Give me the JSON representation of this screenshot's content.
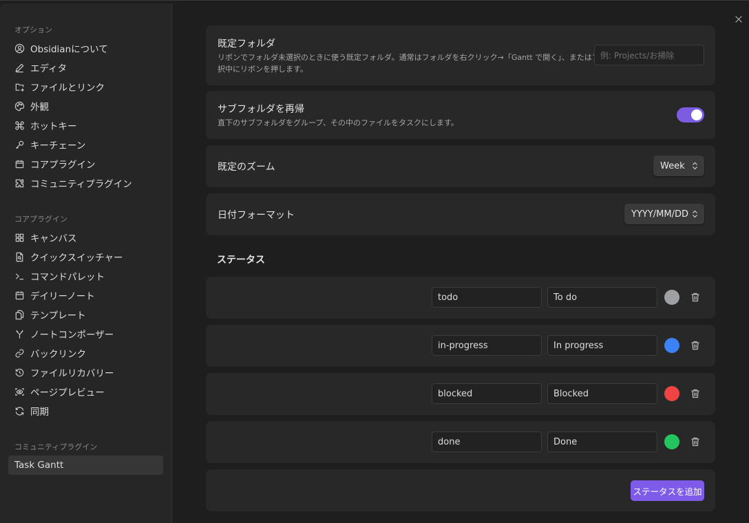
{
  "sidebar": {
    "groups": [
      {
        "label": "オプション",
        "items": [
          {
            "label": "Obsidianについて",
            "icon": "user-circle-icon"
          },
          {
            "label": "エディタ",
            "icon": "pencil-icon"
          },
          {
            "label": "ファイルとリンク",
            "icon": "folder-link-icon"
          },
          {
            "label": "外観",
            "icon": "palette-icon"
          },
          {
            "label": "ホットキー",
            "icon": "command-icon"
          },
          {
            "label": "キーチェーン",
            "icon": "key-icon"
          },
          {
            "label": "コアプラグイン",
            "icon": "plug-icon"
          },
          {
            "label": "コミュニティプラグイン",
            "icon": "puzzle-icon"
          }
        ]
      },
      {
        "label": "コアプラグイン",
        "items": [
          {
            "label": "キャンバス",
            "icon": "layout-grid-icon"
          },
          {
            "label": "クイックスイッチャー",
            "icon": "file-search-icon"
          },
          {
            "label": "コマンドパレット",
            "icon": "terminal-icon"
          },
          {
            "label": "デイリーノート",
            "icon": "calendar-icon"
          },
          {
            "label": "テンプレート",
            "icon": "files-icon"
          },
          {
            "label": "ノートコンポーザー",
            "icon": "merge-icon"
          },
          {
            "label": "バックリンク",
            "icon": "backlink-icon"
          },
          {
            "label": "ファイルリカバリー",
            "icon": "history-icon"
          },
          {
            "label": "ページプレビュー",
            "icon": "scan-eye-icon"
          },
          {
            "label": "同期",
            "icon": "refresh-icon"
          }
        ]
      },
      {
        "label": "コミュニティプラグイン",
        "items": [
          {
            "label": "Task Gantt",
            "icon": "",
            "active": true
          }
        ]
      }
    ]
  },
  "settings": {
    "default_folder": {
      "title": "既定フォルダ",
      "desc_line1": "リボンでフォルダ未選択のときに使う既定フォルダ。通常はフォルダを右クリック→「Gantt で開く」、またはフォルダ選",
      "desc_line2": "択中にリボンを押します。",
      "placeholder": "例: Projects/お掃除"
    },
    "recurse": {
      "title": "サブフォルダを再帰",
      "desc": "直下のサブフォルダをグループ、その中のファイルをタスクにします。",
      "enabled": true
    },
    "zoom": {
      "title": "既定のズーム",
      "value": "Week"
    },
    "date_format": {
      "title": "日付フォーマット",
      "value": "YYYY/MM/DD"
    }
  },
  "statuses": {
    "heading": "ステータス",
    "items": [
      {
        "id": "todo",
        "label": "To do",
        "color": "#9ea0a3"
      },
      {
        "id": "in-progress",
        "label": "In progress",
        "color": "#3b82f6"
      },
      {
        "id": "blocked",
        "label": "Blocked",
        "color": "#ef4444"
      },
      {
        "id": "done",
        "label": "Done",
        "color": "#22c55e"
      }
    ],
    "add_label": "ステータスを追加"
  },
  "colors": {
    "accent": "#7f5bea",
    "toggle_on": "#7c5ce0"
  }
}
